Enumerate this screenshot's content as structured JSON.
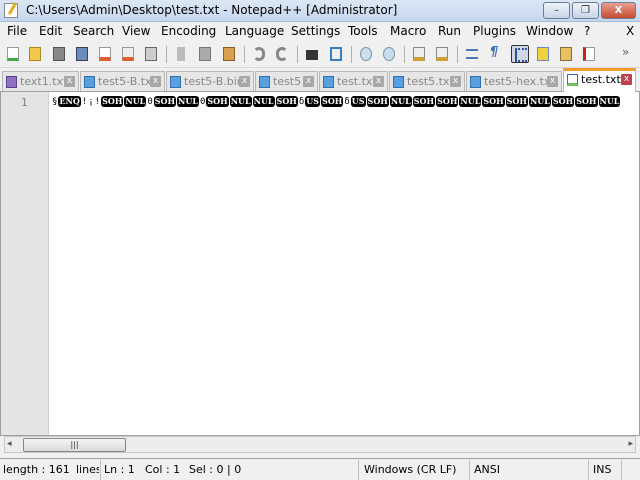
{
  "window": {
    "title": "C:\\Users\\Admin\\Desktop\\test.txt - Notepad++ [Administrator]",
    "minimize": "–",
    "restore": "❐",
    "close": "X"
  },
  "menu": [
    "File",
    "Edit",
    "Search",
    "View",
    "Encoding",
    "Language",
    "Settings",
    "Tools",
    "Macro",
    "Run",
    "Plugins",
    "Window",
    "?"
  ],
  "menu_close": "X",
  "toolbar": {
    "overflow": "»"
  },
  "tabs": [
    {
      "label": "text1.txt",
      "close": "x"
    },
    {
      "label": "test5-B.txt",
      "close": "x"
    },
    {
      "label": "test5-B.bin",
      "close": "x"
    },
    {
      "label": "test5",
      "close": "x"
    },
    {
      "label": "test.txt",
      "close": "x"
    },
    {
      "label": "test5.txt",
      "close": "x"
    },
    {
      "label": "test5-hex.txt",
      "close": "x"
    },
    {
      "label": "test.txt",
      "close": "x",
      "active": true
    }
  ],
  "editor": {
    "line_number": "1",
    "tokens": [
      {
        "t": "§",
        "c": false
      },
      {
        "t": "ENQ",
        "c": true
      },
      {
        "t": "!",
        "c": false
      },
      {
        "t": "¡",
        "c": false
      },
      {
        "t": "!",
        "c": false
      },
      {
        "t": "SOH",
        "c": true
      },
      {
        "t": "NUL",
        "c": true
      },
      {
        "t": "0",
        "c": false
      },
      {
        "t": "SOH",
        "c": true
      },
      {
        "t": "NUL",
        "c": true
      },
      {
        "t": "0",
        "c": false
      },
      {
        "t": "SOH",
        "c": true
      },
      {
        "t": "NUL",
        "c": true
      },
      {
        "t": "NUL",
        "c": true
      },
      {
        "t": "SOH",
        "c": true
      },
      {
        "t": "δ",
        "c": false
      },
      {
        "t": "US",
        "c": true
      },
      {
        "t": "SOH",
        "c": true
      },
      {
        "t": "δ",
        "c": false
      },
      {
        "t": "US",
        "c": true
      },
      {
        "t": "SOH",
        "c": true
      },
      {
        "t": "NUL",
        "c": true
      },
      {
        "t": "SOH",
        "c": true
      },
      {
        "t": "SOH",
        "c": true
      },
      {
        "t": "NUL",
        "c": true
      },
      {
        "t": "SOH",
        "c": true
      },
      {
        "t": "SOH",
        "c": true
      },
      {
        "t": "NUL",
        "c": true
      },
      {
        "t": "SOH",
        "c": true
      },
      {
        "t": "SOH",
        "c": true
      },
      {
        "t": "NUL",
        "c": true
      }
    ]
  },
  "scrollbar": {
    "left": "◂",
    "right": "▸",
    "grip": "|||"
  },
  "status": {
    "length": "length : 161",
    "lines": "lines",
    "ln": "Ln : 1",
    "col": "Col : 1",
    "sel": "Sel : 0 | 0",
    "eol": "Windows (CR LF)",
    "encoding": "ANSI",
    "mode": "INS"
  }
}
